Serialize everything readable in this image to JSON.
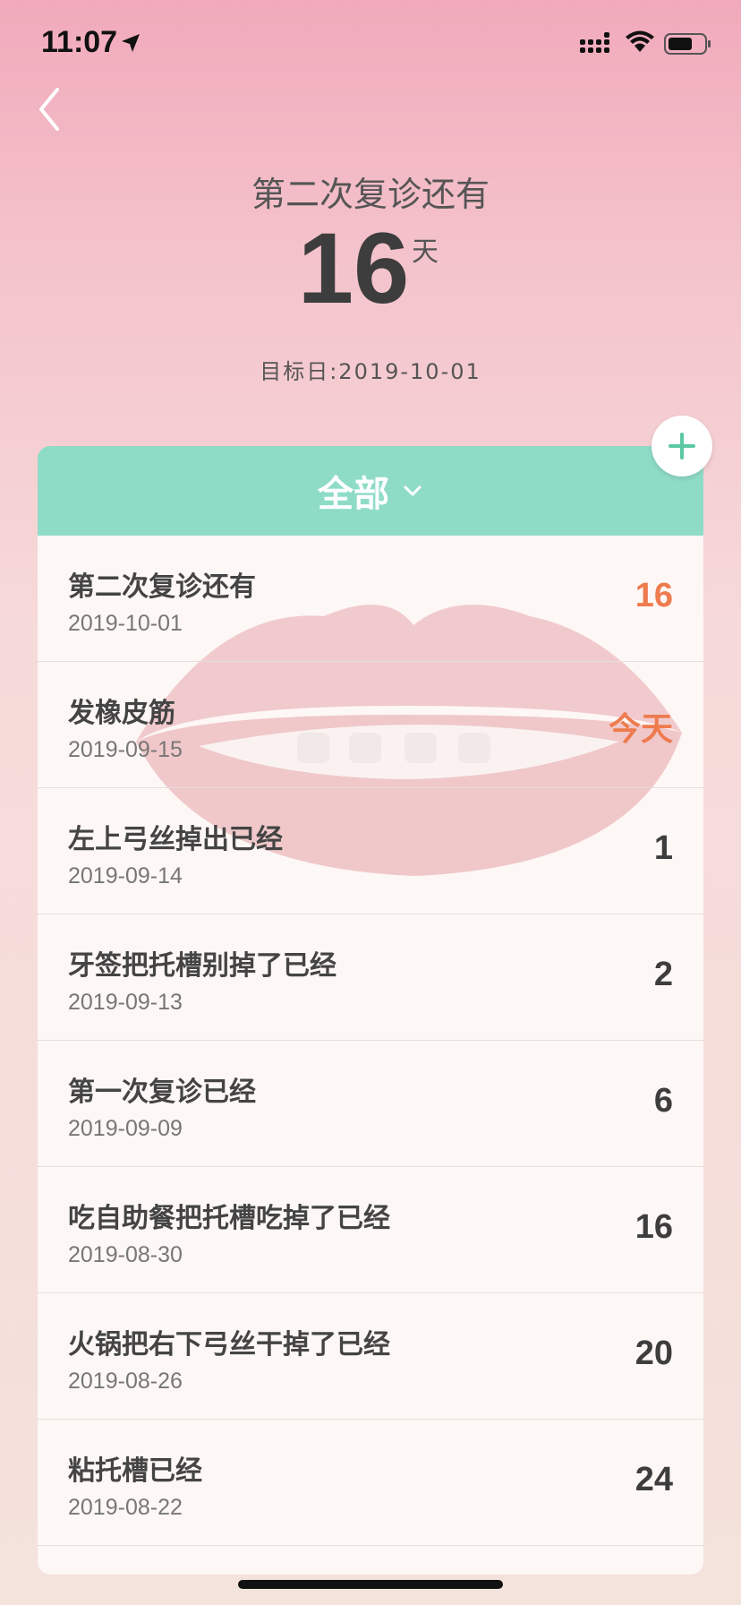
{
  "status_bar": {
    "time": "11:07",
    "icons": [
      "location-arrow-icon",
      "signal-icon",
      "wifi-icon",
      "battery-icon"
    ]
  },
  "nav": {
    "back_icon": "chevron-left-icon"
  },
  "header": {
    "title": "第二次复诊还有",
    "count": "16",
    "unit": "天",
    "target_date": "目标日:2019-10-01"
  },
  "filter": {
    "label": "全部",
    "icon": "chevron-down-icon"
  },
  "add_button": {
    "icon": "plus-icon",
    "color": "#5cc8a4"
  },
  "colors": {
    "accent": "#8fdcc6",
    "highlight": "#ee7b4e",
    "text": "#3d3d3d"
  },
  "events": [
    {
      "title": "第二次复诊还有",
      "date": "2019-10-01",
      "count": "16"
    },
    {
      "title": "发橡皮筋",
      "date": "2019-09-15",
      "count": "今天"
    },
    {
      "title": "左上弓丝掉出已经",
      "date": "2019-09-14",
      "count": "1"
    },
    {
      "title": "牙签把托槽别掉了已经",
      "date": "2019-09-13",
      "count": "2"
    },
    {
      "title": "第一次复诊已经",
      "date": "2019-09-09",
      "count": "6"
    },
    {
      "title": "吃自助餐把托槽吃掉了已经",
      "date": "2019-08-30",
      "count": "16"
    },
    {
      "title": "火锅把右下弓丝干掉了已经",
      "date": "2019-08-26",
      "count": "20"
    },
    {
      "title": "粘托槽已经",
      "date": "2019-08-22",
      "count": "24"
    }
  ]
}
